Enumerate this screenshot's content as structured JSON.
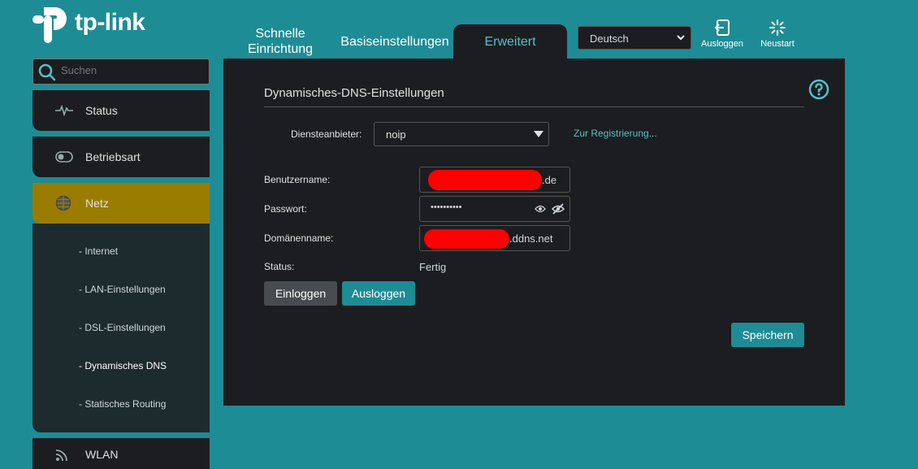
{
  "brand": {
    "name": "tp-link"
  },
  "tabs": {
    "quick_line1": "Schnelle",
    "quick_line2": "Einrichtung",
    "basic": "Basiseinstellungen",
    "advanced": "Erweitert"
  },
  "language": {
    "selected": "Deutsch"
  },
  "top_actions": {
    "logout": "Ausloggen",
    "reboot": "Neustart"
  },
  "search": {
    "placeholder": "Suchen"
  },
  "sidebar": {
    "items": [
      {
        "label": "Status",
        "icon": "heartbeat-icon"
      },
      {
        "label": "Betriebsart",
        "icon": "toggle-icon"
      },
      {
        "label": "Netz",
        "icon": "globe-icon"
      },
      {
        "label": "WLAN",
        "icon": "wifi-icon"
      }
    ],
    "subitems": [
      "- Internet",
      "- LAN-Einstellungen",
      "- DSL-Einstellungen",
      "- Dynamisches DNS",
      "- Statisches Routing"
    ]
  },
  "main": {
    "title": "Dynamisches-DNS-Einstellungen",
    "provider_label": "Diensteanbieter:",
    "provider_value": "noip",
    "register_link": "Zur Registrierung...",
    "username_label": "Benutzername:",
    "username_suffix": ".de",
    "password_label": "Passwort:",
    "password_value": "••••••••••",
    "domain_label": "Domänenname:",
    "domain_suffix": ".ddns.net",
    "status_label": "Status:",
    "status_value": "Fertig",
    "login_button": "Einloggen",
    "logout_button": "Ausloggen",
    "save_button": "Speichern"
  },
  "colors": {
    "accent": "#1e8c95",
    "active_nav": "#9a7d00",
    "panel": "#1c1d20",
    "link": "#55c0ca",
    "redaction": "#ff0000"
  }
}
